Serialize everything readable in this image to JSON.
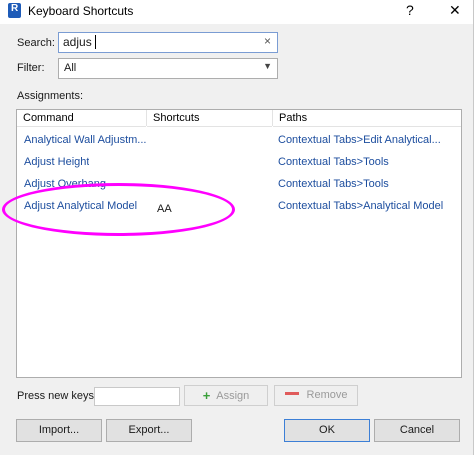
{
  "window": {
    "title": "Keyboard Shortcuts",
    "help_label": "?",
    "close_label": "✕"
  },
  "search": {
    "label": "Search:",
    "value": "adjus",
    "clear_label": "×"
  },
  "filter": {
    "label": "Filter:",
    "value": "All"
  },
  "assignments": {
    "label": "Assignments:",
    "columns": [
      "Command",
      "Shortcuts",
      "Paths"
    ],
    "rows": [
      {
        "command": "Analytical Wall Adjustm...",
        "shortcuts": "",
        "paths": "Contextual Tabs>Edit Analytical..."
      },
      {
        "command": "Adjust Height",
        "shortcuts": "",
        "paths": "Contextual Tabs>Tools"
      },
      {
        "command": "Adjust Overhang",
        "shortcuts": "",
        "paths": "Contextual Tabs>Tools"
      },
      {
        "command": "Adjust Analytical Model",
        "shortcuts": "AA",
        "paths": "Contextual Tabs>Analytical Model"
      }
    ]
  },
  "new_keys": {
    "label": "Press new keys:",
    "value": ""
  },
  "buttons": {
    "assign": "Assign",
    "remove": "Remove",
    "import": "Import...",
    "export": "Export...",
    "ok": "OK",
    "cancel": "Cancel"
  },
  "colors": {
    "annotation": "#ff00ff",
    "link_text": "#1c4d9e"
  }
}
